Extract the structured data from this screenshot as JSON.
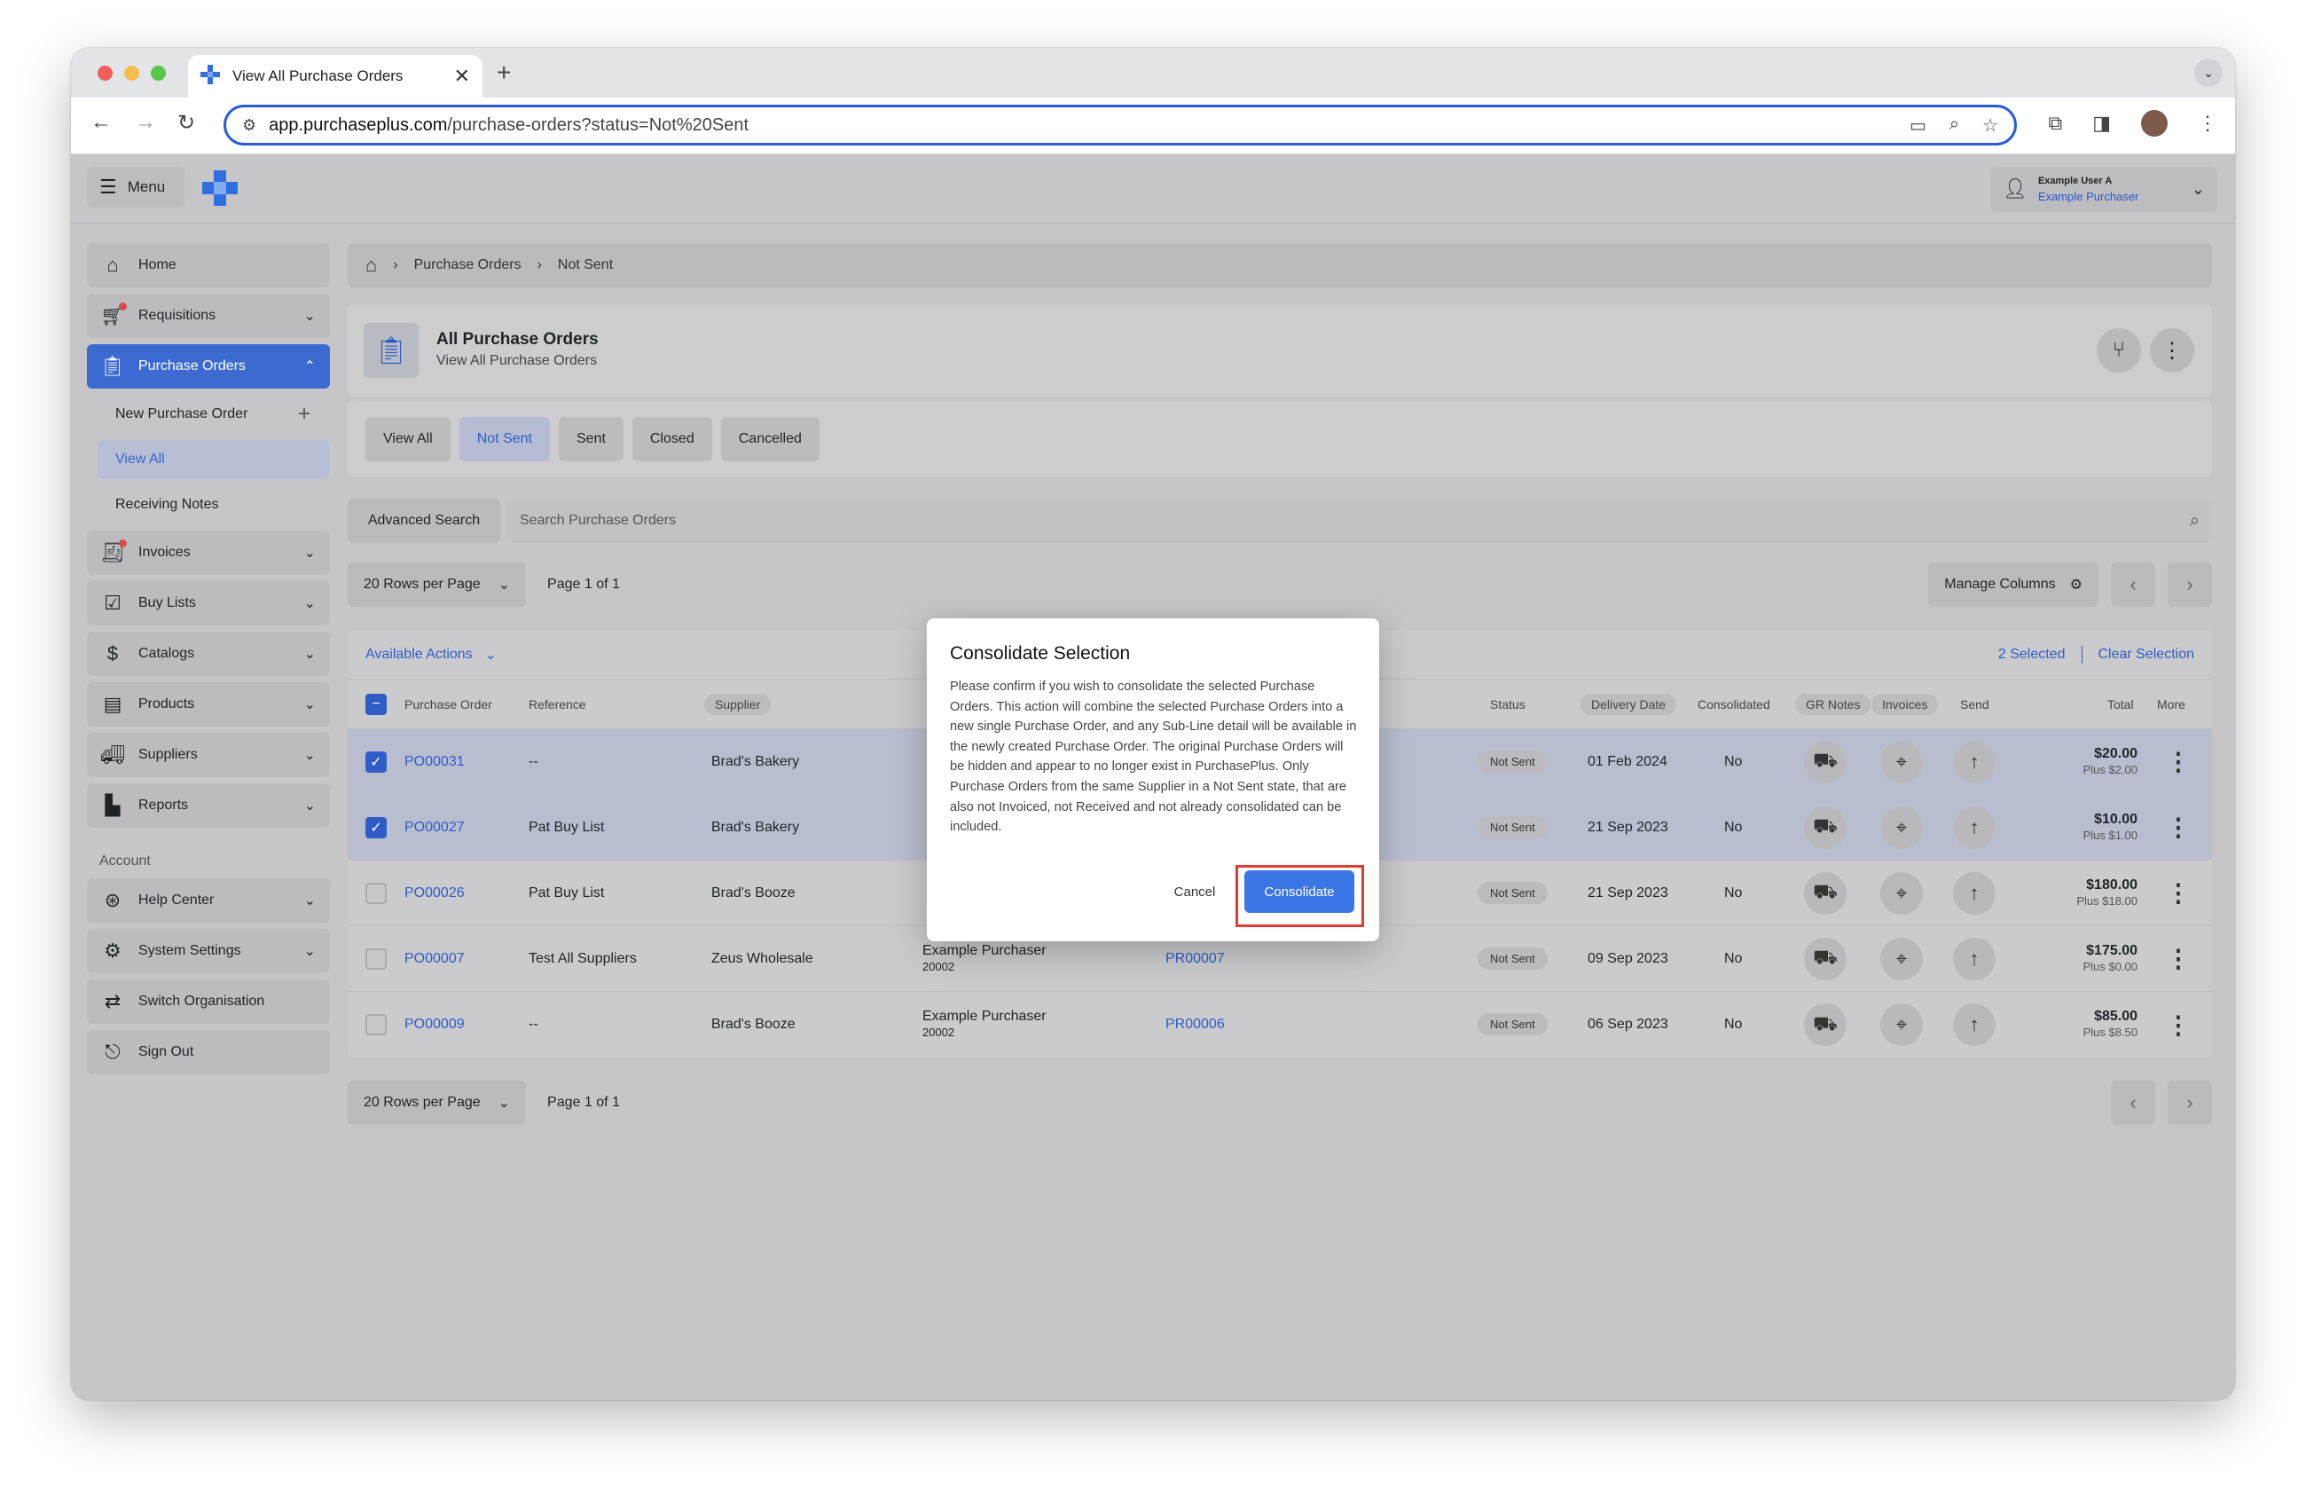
{
  "browser": {
    "tab_title": "View All Purchase Orders",
    "url_host": "app.purchaseplus.com",
    "url_path": "/purchase-orders?status=Not%20Sent"
  },
  "header": {
    "menu_label": "Menu",
    "user_name": "Example User A",
    "user_org": "Example Purchaser"
  },
  "sidebar": {
    "items": [
      {
        "label": "Home",
        "icon": "home-icon"
      },
      {
        "label": "Requisitions",
        "icon": "cart-icon"
      },
      {
        "label": "Purchase Orders",
        "icon": "clipboard-icon"
      },
      {
        "label": "Invoices",
        "icon": "invoice-icon"
      },
      {
        "label": "Buy Lists",
        "icon": "checklist-icon"
      },
      {
        "label": "Catalogs",
        "icon": "catalog-icon"
      },
      {
        "label": "Products",
        "icon": "products-icon"
      },
      {
        "label": "Suppliers",
        "icon": "truck-icon"
      },
      {
        "label": "Reports",
        "icon": "chart-icon"
      }
    ],
    "sub_items": [
      "New Purchase Order",
      "View All",
      "Receiving Notes"
    ],
    "account_label": "Account",
    "account_items": [
      {
        "label": "Help Center",
        "icon": "lifebuoy-icon"
      },
      {
        "label": "System Settings",
        "icon": "gear-icon"
      },
      {
        "label": "Switch Organisation",
        "icon": "switch-icon"
      },
      {
        "label": "Sign Out",
        "icon": "signout-icon"
      }
    ]
  },
  "breadcrumb": [
    "Purchase Orders",
    "Not Sent"
  ],
  "page": {
    "title": "All Purchase Orders",
    "subtitle": "View All Purchase Orders"
  },
  "filters": [
    "View All",
    "Not Sent",
    "Sent",
    "Closed",
    "Cancelled"
  ],
  "search": {
    "advanced_label": "Advanced Search",
    "placeholder": "Search Purchase Orders"
  },
  "pager": {
    "rows_label": "20 Rows per Page",
    "page_label": "Page 1 of 1",
    "manage_columns": "Manage Columns"
  },
  "table": {
    "available_actions": "Available Actions",
    "selected_count": "2 Selected",
    "clear_selection": "Clear Selection",
    "columns": [
      "Purchase Order",
      "Reference",
      "Supplier",
      "Status",
      "Delivery Date",
      "Consolidated",
      "GR Notes",
      "Invoices",
      "Send",
      "Total",
      "More"
    ],
    "rows": [
      {
        "po": "PO00031",
        "reference": "--",
        "supplier": "Brad's Bakery",
        "dept": "",
        "dept_code": "",
        "req": "",
        "status": "Not Sent",
        "date": "01 Feb 2024",
        "consolidated": "No",
        "total": "$20.00",
        "tax": "Plus $2.00",
        "selected": true
      },
      {
        "po": "PO00027",
        "reference": "Pat Buy List",
        "supplier": "Brad's Bakery",
        "dept": "",
        "dept_code": "",
        "req": "",
        "status": "Not Sent",
        "date": "21 Sep 2023",
        "consolidated": "No",
        "total": "$10.00",
        "tax": "Plus $1.00",
        "selected": true
      },
      {
        "po": "PO00026",
        "reference": "Pat Buy List",
        "supplier": "Brad's Booze",
        "dept": "",
        "dept_code": "",
        "req": "",
        "status": "Not Sent",
        "date": "21 Sep 2023",
        "consolidated": "No",
        "total": "$180.00",
        "tax": "Plus $18.00",
        "selected": false
      },
      {
        "po": "PO00007",
        "reference": "Test All Suppliers",
        "supplier": "Zeus Wholesale",
        "dept": "Example Purchaser",
        "dept_code": "20002",
        "req": "PR00007",
        "status": "Not Sent",
        "date": "09 Sep 2023",
        "consolidated": "No",
        "total": "$175.00",
        "tax": "Plus $0.00",
        "selected": false
      },
      {
        "po": "PO00009",
        "reference": "--",
        "supplier": "Brad's Booze",
        "dept": "Example Purchaser",
        "dept_code": "20002",
        "req": "PR00006",
        "status": "Not Sent",
        "date": "06 Sep 2023",
        "consolidated": "No",
        "total": "$85.00",
        "tax": "Plus $8.50",
        "selected": false
      }
    ]
  },
  "modal": {
    "title": "Consolidate Selection",
    "body": "Please confirm if you wish to consolidate the selected Purchase Orders. This action will combine the selected Purchase Orders into a new single Purchase Order, and any Sub-Line detail will be available in the newly created Purchase Order. The original Purchase Orders will be hidden and appear to no longer exist in PurchasePlus. Only Purchase Orders from the same Supplier in a Not Sent state, that are also not Invoiced, not Received and not already consolidated can be included.",
    "cancel_label": "Cancel",
    "confirm_label": "Consolidate"
  },
  "colors": {
    "accent": "#3b76e6",
    "link": "#2f5cc6",
    "highlight": "#e23b2f"
  }
}
